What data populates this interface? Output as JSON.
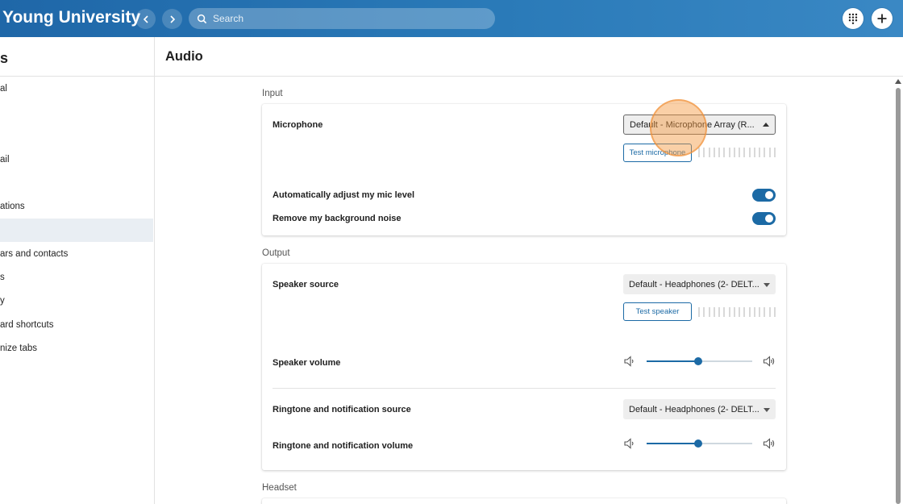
{
  "header": {
    "brand": "Young University",
    "search_placeholder": "Search"
  },
  "sidebar": {
    "title": "s",
    "items": [
      {
        "label": "al",
        "active": false
      },
      {
        "label": "ail",
        "active": false
      },
      {
        "label": "ations",
        "active": false
      },
      {
        "label": "",
        "active": true
      },
      {
        "label": "ars and contacts",
        "active": false
      },
      {
        "label": "s",
        "active": false
      },
      {
        "label": "y",
        "active": false
      },
      {
        "label": "ard shortcuts",
        "active": false
      },
      {
        "label": "nize tabs",
        "active": false
      }
    ]
  },
  "page": {
    "title": "Audio"
  },
  "input": {
    "section_label": "Input",
    "microphone_label": "Microphone",
    "microphone_value": "Default - Microphone Array (R...",
    "test_microphone_label": "Test microphone",
    "auto_adjust_label": "Automatically adjust my mic level",
    "auto_adjust_on": true,
    "noise_label": "Remove my background noise",
    "noise_on": true
  },
  "output": {
    "section_label": "Output",
    "speaker_source_label": "Speaker source",
    "speaker_source_value": "Default - Headphones (2- DELT...",
    "test_speaker_label": "Test speaker",
    "speaker_volume_label": "Speaker volume",
    "speaker_volume_fraction": 0.49,
    "ringtone_source_label": "Ringtone and notification source",
    "ringtone_source_value": "Default - Headphones (2- DELT...",
    "ringtone_volume_label": "Ringtone and notification volume",
    "ringtone_volume_fraction": 0.49
  },
  "headset": {
    "section_label": "Headset"
  },
  "colors": {
    "accent": "#1c6aa5",
    "topbar": "#2a7ab8"
  }
}
